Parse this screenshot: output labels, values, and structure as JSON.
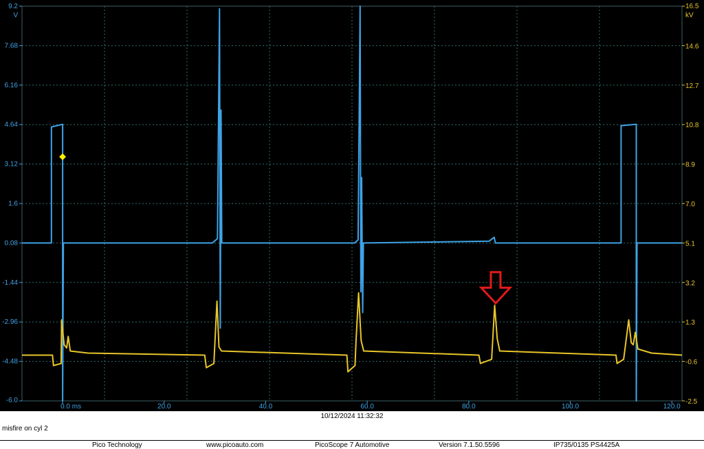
{
  "chart_data": {
    "type": "line",
    "xlabel": "ms",
    "x_ticks": [
      "0.0 ms",
      "20.0",
      "40.0",
      "60.0",
      "80.0",
      "100.0",
      "120.0"
    ],
    "xlim": [
      -8,
      122
    ],
    "left_axis": {
      "unit": "V",
      "color": "#3fa3e6",
      "ticks": [
        "9.2",
        "7.68",
        "6.16",
        "4.64",
        "3.12",
        "1.6",
        "0.08",
        "-1.44",
        "-2.96",
        "-4.48",
        "-6.0"
      ],
      "ylim": [
        -6.0,
        9.2
      ]
    },
    "right_axis": {
      "unit": "kV",
      "color": "#e8c62a",
      "ticks": [
        "16.5",
        "14.6",
        "12.7",
        "10.8",
        "8.9",
        "7.0",
        "5.1",
        "3.2",
        "1.3",
        "-0.6",
        "-2.5"
      ],
      "ylim": [
        -2.5,
        16.5
      ]
    },
    "grid": true,
    "series": [
      {
        "color": "#3fa3e6",
        "axis": "left",
        "points": [
          [
            -8,
            0.08
          ],
          [
            -2.2,
            0.08
          ],
          [
            -2.2,
            4.55
          ],
          [
            0,
            4.65
          ],
          [
            0,
            -6.0
          ],
          [
            0.15,
            0.08
          ],
          [
            29.5,
            0.08
          ],
          [
            30.5,
            0.25
          ],
          [
            30.9,
            9.1
          ],
          [
            31.05,
            -3.2
          ],
          [
            31.2,
            5.2
          ],
          [
            31.35,
            0.08
          ],
          [
            57.5,
            0.08
          ],
          [
            58.2,
            0.2
          ],
          [
            58.6,
            9.2
          ],
          [
            58.75,
            -1.8
          ],
          [
            58.9,
            2.6
          ],
          [
            59.1,
            -2.6
          ],
          [
            59.25,
            0.08
          ],
          [
            84,
            0.15
          ],
          [
            85,
            0.3
          ],
          [
            85.25,
            0.08
          ],
          [
            110,
            0.08
          ],
          [
            110,
            4.6
          ],
          [
            113,
            4.65
          ],
          [
            113,
            -6.0
          ],
          [
            113.15,
            0.08
          ],
          [
            122,
            0.08
          ]
        ]
      },
      {
        "color": "#e8c62a",
        "axis": "right",
        "points": [
          [
            -8,
            -0.3
          ],
          [
            -2,
            -0.3
          ],
          [
            -1.8,
            -0.8
          ],
          [
            -0.3,
            -0.7
          ],
          [
            -0.2,
            1.4
          ],
          [
            0.3,
            0.2
          ],
          [
            0.8,
            0.05
          ],
          [
            1.1,
            0.6
          ],
          [
            1.5,
            -0.1
          ],
          [
            5,
            -0.2
          ],
          [
            28,
            -0.3
          ],
          [
            28.3,
            -0.9
          ],
          [
            29.8,
            -0.7
          ],
          [
            30,
            0.3
          ],
          [
            30.4,
            2.3
          ],
          [
            30.8,
            0.1
          ],
          [
            31.3,
            -0.1
          ],
          [
            56,
            -0.3
          ],
          [
            56.2,
            -1.1
          ],
          [
            57.6,
            -0.8
          ],
          [
            57.8,
            0.4
          ],
          [
            58.3,
            2.7
          ],
          [
            58.8,
            0.4
          ],
          [
            59.3,
            -0.1
          ],
          [
            82,
            -0.3
          ],
          [
            82.3,
            -0.7
          ],
          [
            84.5,
            -0.5
          ],
          [
            85.1,
            2.1
          ],
          [
            85.6,
            0.5
          ],
          [
            86.1,
            -0.1
          ],
          [
            109,
            -0.3
          ],
          [
            109.2,
            -0.7
          ],
          [
            110.5,
            -0.5
          ],
          [
            111.5,
            1.4
          ],
          [
            112,
            0.3
          ],
          [
            112.4,
            0.2
          ],
          [
            112.8,
            0.8
          ],
          [
            113.3,
            0.0
          ],
          [
            116,
            -0.2
          ],
          [
            122,
            -0.3
          ]
        ]
      }
    ],
    "trigger_marker": {
      "x": 0,
      "y": 3.4,
      "color": "#ffee00"
    },
    "annotation_arrow": {
      "x": 85.3,
      "y_top_kv": 3.7,
      "y_bottom_kv": 2.2,
      "color": "#e01b1b"
    }
  },
  "timestamp": "10/12/2024 11:32:32",
  "caption": "misfire on cyl 2",
  "footer": {
    "company": "Pico Technology",
    "website": "www.picoauto.com",
    "product": "PicoScope 7 Automotive",
    "version": "Version 7.1.50.5596",
    "device": "IP735/0135 PS4425A"
  }
}
